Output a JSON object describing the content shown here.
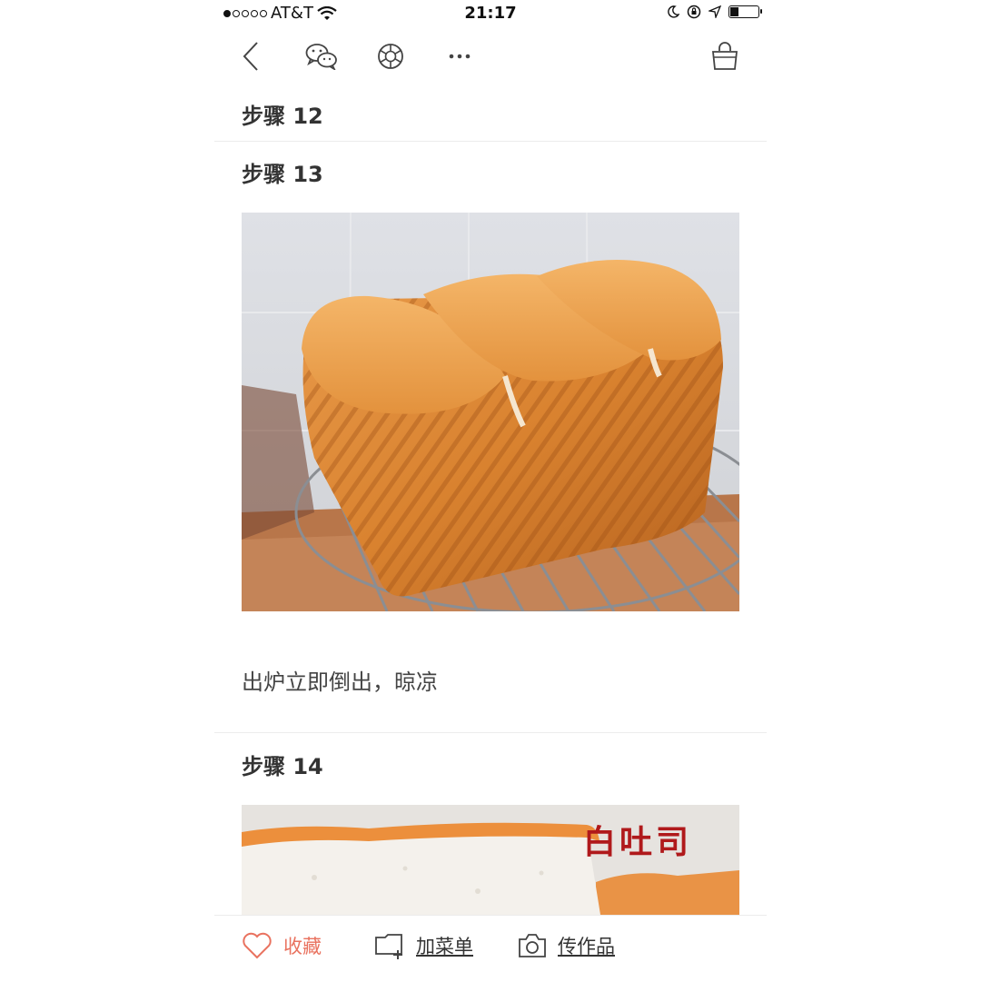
{
  "status_bar": {
    "carrier": "AT&T",
    "time": "21:17",
    "signal_dots_filled": 1,
    "signal_dots_total": 5,
    "battery_level": 0.2
  },
  "nav": {
    "icons": [
      "back-chevron-icon",
      "wechat-icon",
      "moments-icon",
      "more-icon",
      "basket-icon"
    ]
  },
  "steps": [
    {
      "title": "步骤 12"
    },
    {
      "title": "步骤 13",
      "description": "出炉立即倒出，晾凉"
    },
    {
      "title": "步骤 14",
      "image_caption": "白吐司"
    }
  ],
  "bottom_bar": {
    "favorite_label": "收藏",
    "add_menu_label": "加菜单",
    "upload_label": "传作品"
  },
  "colors": {
    "accent": "#e9725f",
    "text": "#333333",
    "divider": "#ececec",
    "caption_red": "#b0191b"
  }
}
